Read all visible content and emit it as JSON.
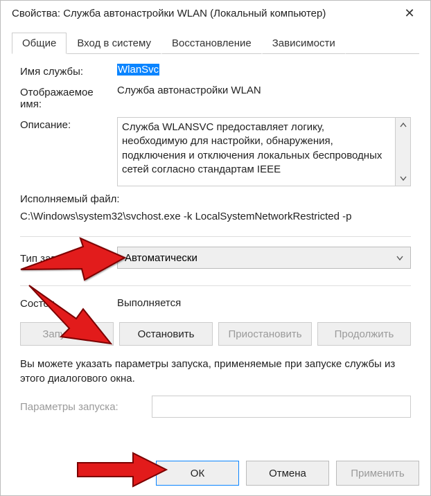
{
  "title": "Свойства: Служба автонастройки WLAN (Локальный компьютер)",
  "tabs": {
    "general": "Общие",
    "logon": "Вход в систему",
    "recovery": "Восстановление",
    "deps": "Зависимости"
  },
  "labels": {
    "service_name": "Имя службы:",
    "display_name": "Отображаемое имя:",
    "description": "Описание:",
    "exe": "Исполняемый файл:",
    "startup_type": "Тип запуска:",
    "status": "Состоя",
    "start_params": "Параметры запуска:"
  },
  "values": {
    "service_name": "WlanSvc",
    "display_name": "Служба автонастройки WLAN",
    "description": "Служба WLANSVC предоставляет логику, необходимую для настройки, обнаружения, подключения и отключения локальных беспроводных сетей согласно стандартам IEEE",
    "exe_path": "C:\\Windows\\system32\\svchost.exe -k LocalSystemNetworkRestricted -p",
    "startup_type": "Автоматически",
    "status": "Выполняется",
    "hint": "Вы можете указать параметры запуска, применяемые при запуске службы из этого диалогового окна."
  },
  "buttons": {
    "start": "Запустить",
    "stop": "Остановить",
    "pause": "Приостановить",
    "resume": "Продолжить",
    "ok": "ОК",
    "cancel": "Отмена",
    "apply": "Применить"
  }
}
